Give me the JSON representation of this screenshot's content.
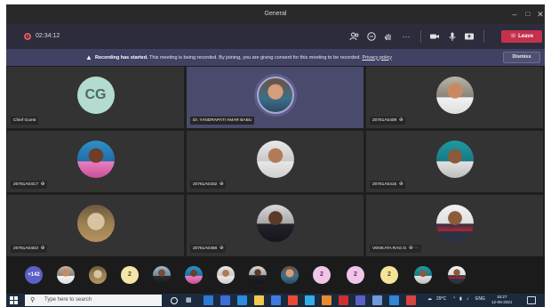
{
  "window": {
    "title": "General"
  },
  "toolbar": {
    "timer": "02:34:12",
    "leave_label": "Leave"
  },
  "banner": {
    "bold_text": "Recording has started.",
    "text": "This meeting is being recorded. By joining, you are giving consent for this meeting to be recorded.",
    "link_text": "Privacy policy",
    "dismiss_label": "Dismiss"
  },
  "participants": [
    {
      "name": "Chief Guest",
      "initials": "CG",
      "muted": false
    },
    {
      "name": "Dr. YANDRAPATI AMAR BABU",
      "muted": false,
      "active_speaker": true
    },
    {
      "name": "20761A0409",
      "muted": true
    },
    {
      "name": "20761A04C7",
      "muted": true
    },
    {
      "name": "20761A0402",
      "muted": true
    },
    {
      "name": "20761A0415",
      "muted": true
    },
    {
      "name": "20761A04D2",
      "muted": true
    },
    {
      "name": "20761A0468",
      "muted": true
    },
    {
      "name": "VENKATA RAO.G",
      "muted": true,
      "more": "···"
    }
  ],
  "strip": {
    "overflow_count": "+142",
    "initial_label": "2"
  },
  "taskbar": {
    "search_placeholder": "Type here to search",
    "weather": "29°C",
    "language": "ENG",
    "time": "16:27",
    "date": "12-06-2021"
  },
  "colors": {
    "leave": "#c4314b",
    "banner": "#414164",
    "accent": "#5b5fc7"
  }
}
